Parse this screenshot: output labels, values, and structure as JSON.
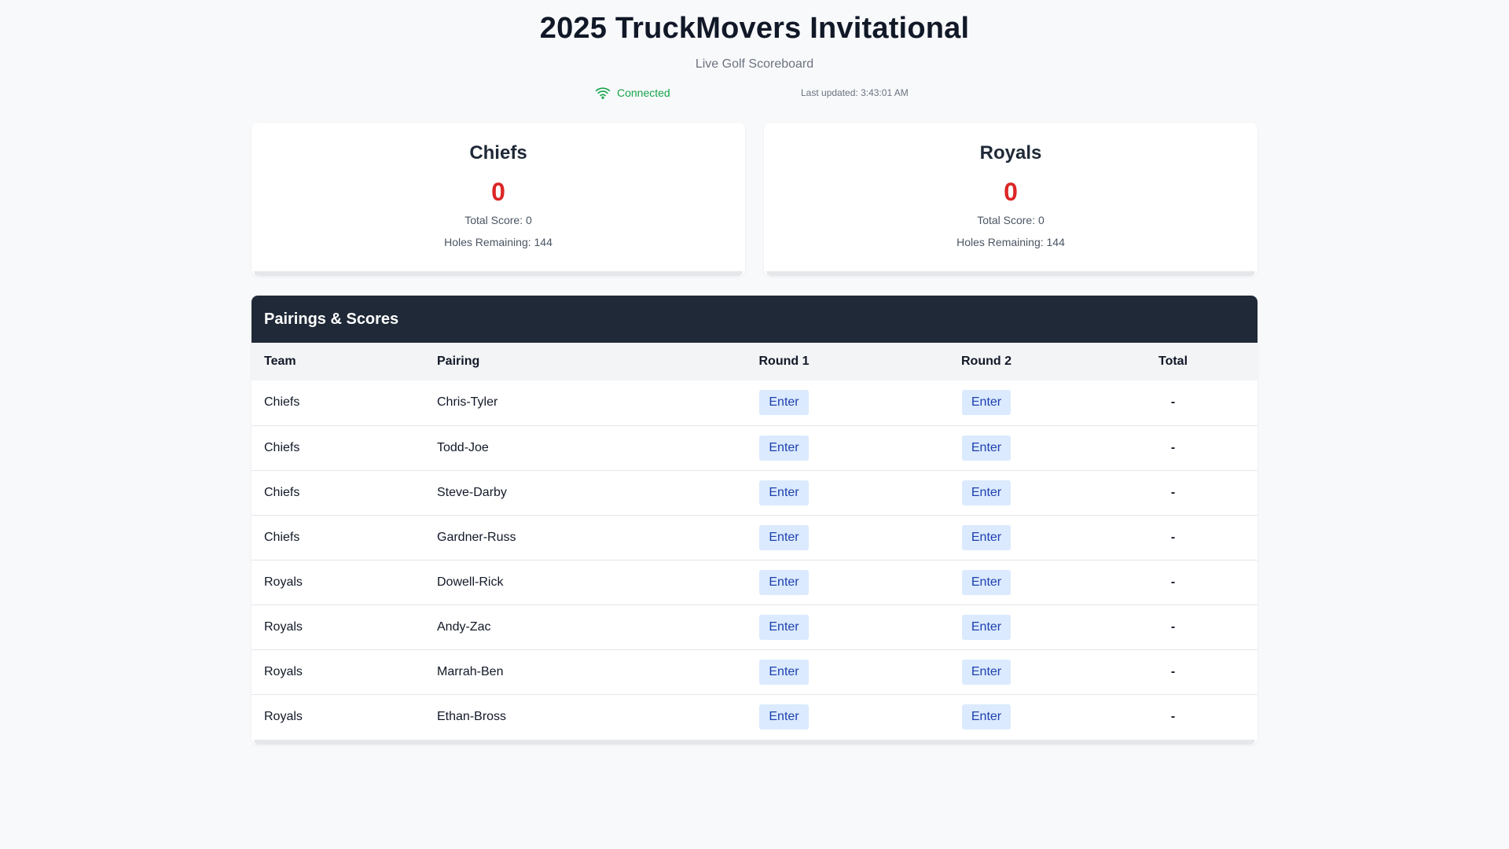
{
  "header": {
    "title": "2025 TruckMovers Invitational",
    "subtitle": "Live Golf Scoreboard"
  },
  "status": {
    "connection_label": "Connected",
    "connection_icon": "wifi-icon",
    "connection_color": "#16a34a",
    "last_updated_label": "Last updated:",
    "last_updated_time": "3:43:01 AM"
  },
  "teams": [
    {
      "name": "Chiefs",
      "points": "0",
      "total_score_label": "Total Score: 0",
      "holes_remaining_label": "Holes Remaining: 144"
    },
    {
      "name": "Royals",
      "points": "0",
      "total_score_label": "Total Score: 0",
      "holes_remaining_label": "Holes Remaining: 144"
    }
  ],
  "pairings_panel": {
    "title": "Pairings & Scores",
    "columns": [
      "Team",
      "Pairing",
      "Round 1",
      "Round 2",
      "Total"
    ],
    "enter_label": "Enter",
    "rows": [
      {
        "team": "Chiefs",
        "pairing": "Chris-Tyler",
        "total": "-"
      },
      {
        "team": "Chiefs",
        "pairing": "Todd-Joe",
        "total": "-"
      },
      {
        "team": "Chiefs",
        "pairing": "Steve-Darby",
        "total": "-"
      },
      {
        "team": "Chiefs",
        "pairing": "Gardner-Russ",
        "total": "-"
      },
      {
        "team": "Royals",
        "pairing": "Dowell-Rick",
        "total": "-"
      },
      {
        "team": "Royals",
        "pairing": "Andy-Zac",
        "total": "-"
      },
      {
        "team": "Royals",
        "pairing": "Marrah-Ben",
        "total": "-"
      },
      {
        "team": "Royals",
        "pairing": "Ethan-Bross",
        "total": "-"
      }
    ]
  },
  "colors": {
    "accent_dark": "#1f2937",
    "score_red": "#dc2626",
    "button_bg": "#dbeafe",
    "button_text": "#1e40af"
  }
}
